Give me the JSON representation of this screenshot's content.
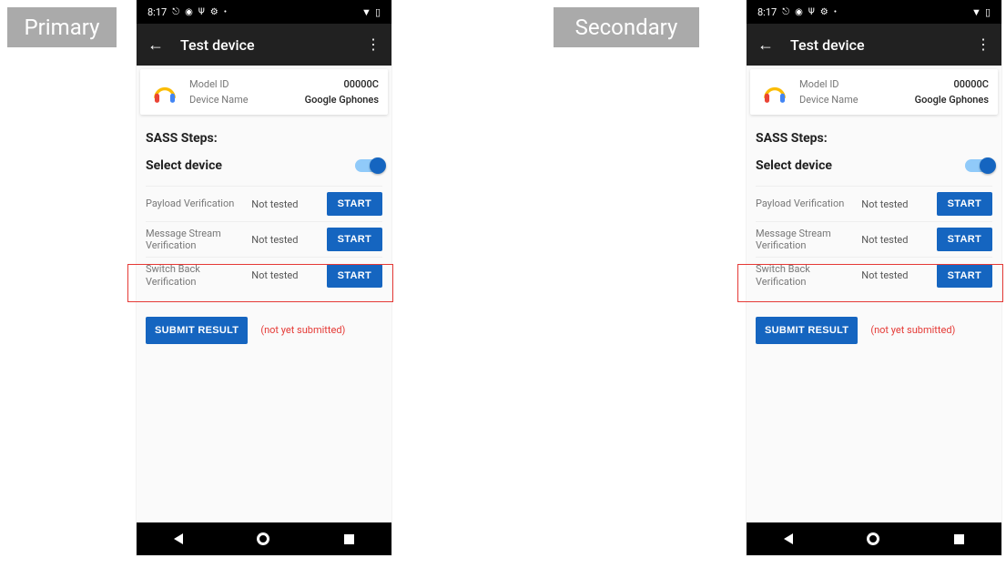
{
  "labels": {
    "primary": "Primary",
    "secondary": "Secondary"
  },
  "status": {
    "time": "8:17",
    "icons_left": [
      "⟳",
      "◉",
      "⚒",
      "⚙",
      "•"
    ],
    "wifi": "▾",
    "battery": "▮"
  },
  "appbar": {
    "title": "Test device"
  },
  "device_card": {
    "model_id_label": "Model ID",
    "model_id_value": "00000C",
    "device_name_label": "Device Name",
    "device_name_value": "Google Gphones"
  },
  "sass_title": "SASS Steps:",
  "select_device_label": "Select device",
  "tests": [
    {
      "name": "Payload Verification",
      "status": "Not tested",
      "btn": "START"
    },
    {
      "name": "Message Stream Verification",
      "status": "Not tested",
      "btn": "START"
    },
    {
      "name": "Switch Back Verification",
      "status": "Not tested",
      "btn": "START"
    }
  ],
  "submit": {
    "btn": "SUBMIT RESULT",
    "note": "(not yet submitted)"
  }
}
